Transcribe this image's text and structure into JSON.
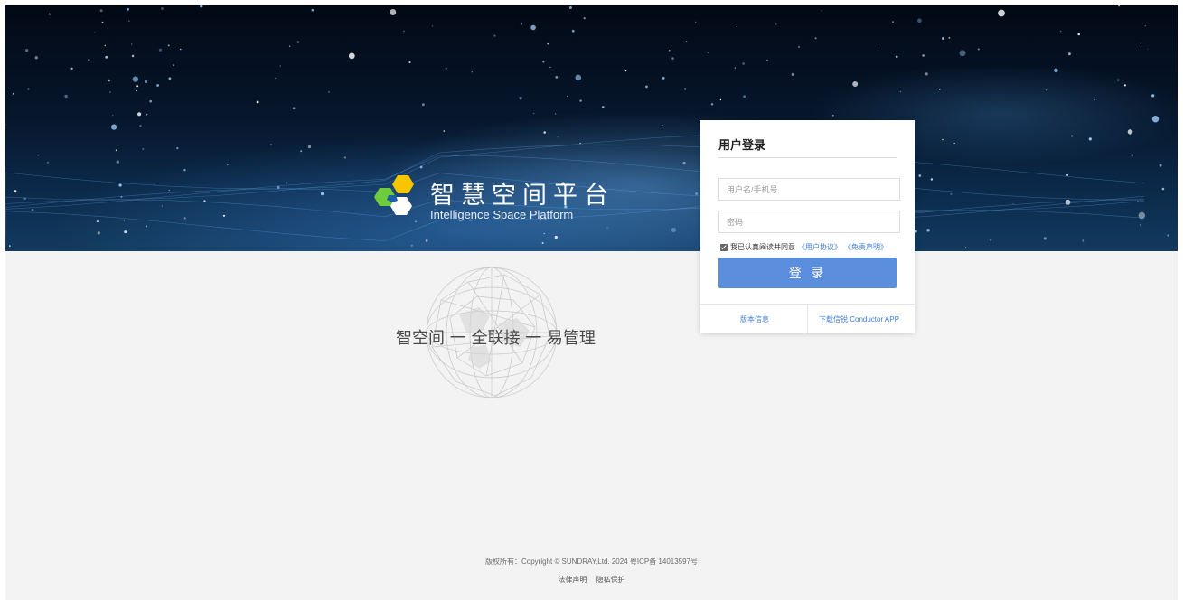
{
  "brand": {
    "title": "智慧空间平台",
    "subtitle": "Intelligence Space Platform",
    "logo_colors": [
      "#f7c600",
      "#6ecb3c",
      "#ffffff",
      "#1e5fa8"
    ]
  },
  "slogan": "智空间 一 全联接 一 易管理",
  "login": {
    "title": "用户登录",
    "username_placeholder": "用户名/手机号",
    "password_placeholder": "密码",
    "agree_text": "我已认真阅读并同意",
    "user_agreement": "《用户协议》",
    "disclaimer": "《免责声明》",
    "agree_checked": true,
    "submit_label": "登 录",
    "version_link": "版本信息",
    "download_link": "下载信锐 Conductor APP"
  },
  "footer": {
    "copyright": "版权所有：Copyright © SUNDRAY,Ltd. 2024 粤ICP备 14013597号",
    "links": [
      "法律声明",
      "隐私保护"
    ]
  },
  "colors": {
    "accent": "#5b8fdd",
    "link": "#3f7fd8",
    "background": "#f3f3f3",
    "banner": "#06162b"
  },
  "icons": [
    "checkbox-checked-icon",
    "brand-hexagon-logo",
    "globe-wireframe"
  ]
}
